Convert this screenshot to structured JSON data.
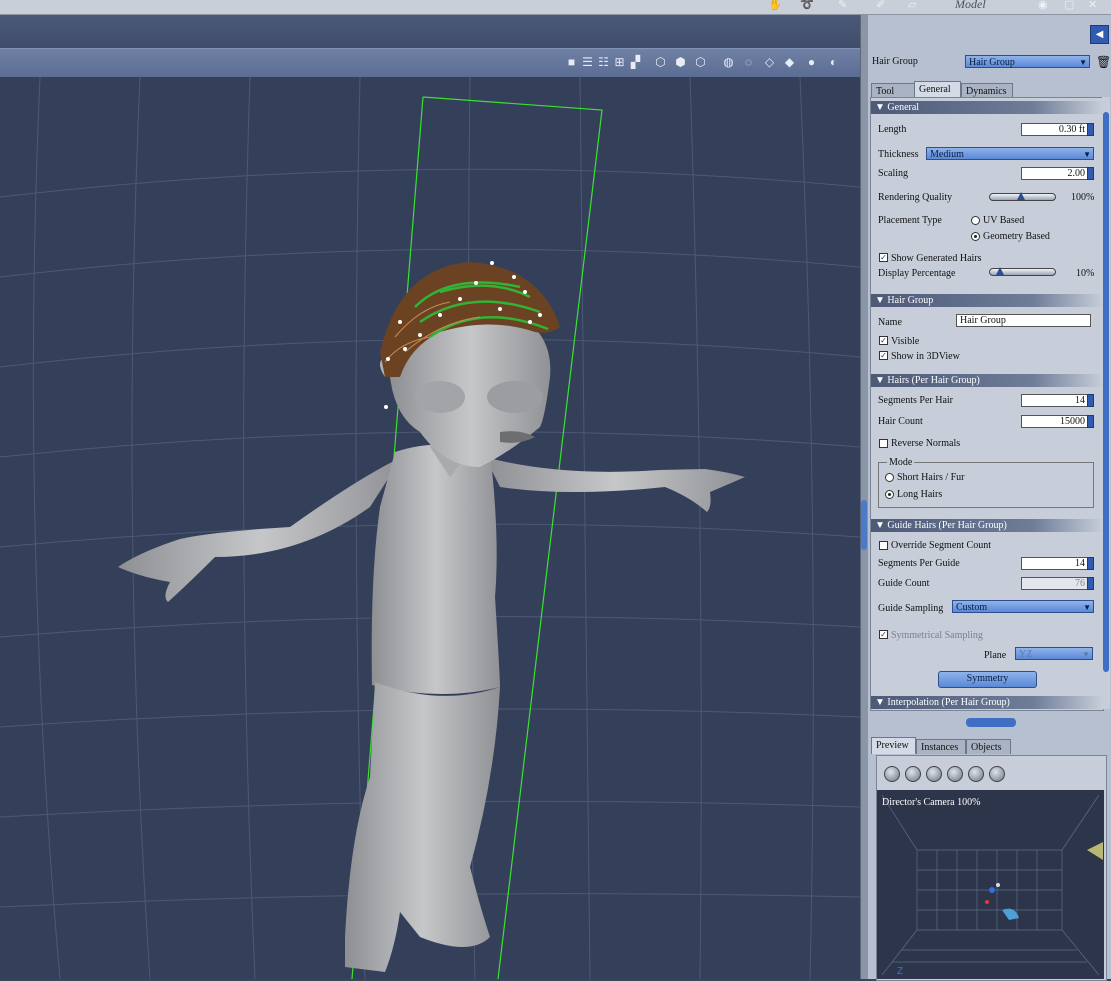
{
  "topbar": {
    "mode_label": "Model"
  },
  "hair_group_selector": {
    "label": "Hair Group",
    "value": "Hair Group"
  },
  "tabs": [
    "Tool",
    "General",
    "Dynamics"
  ],
  "active_tab": "General",
  "sections": {
    "general": {
      "title": "General",
      "length_label": "Length",
      "length_value": "0.30 ft",
      "thickness_label": "Thickness",
      "thickness_value": "Medium",
      "scaling_label": "Scaling",
      "scaling_value": "2.00",
      "rendering_quality_label": "Rendering Quality",
      "rendering_quality_value": "100%",
      "rendering_quality_level": 0.45,
      "placement_type_label": "Placement Type",
      "placement_options": [
        "UV Based",
        "Geometry Based"
      ],
      "placement_selected": "Geometry Based",
      "show_generated_label": "Show Generated Hairs",
      "show_generated_checked": true,
      "display_percentage_label": "Display Percentage",
      "display_percentage_value": "10%",
      "display_percentage_level": 0.1
    },
    "hair_group": {
      "title": "Hair Group",
      "name_label": "Name",
      "name_value": "Hair Group",
      "visible_label": "Visible",
      "show_3d_label": "Show in 3DView"
    },
    "hairs": {
      "title": "Hairs (Per Hair Group)",
      "segments_label": "Segments Per Hair",
      "segments_value": "14",
      "count_label": "Hair Count",
      "count_value": "15000",
      "reverse_label": "Reverse Normals",
      "mode_label": "Mode",
      "mode_options": [
        "Short Hairs / Fur",
        "Long Hairs"
      ],
      "mode_selected": "Long Hairs"
    },
    "guide_hairs": {
      "title": "Guide Hairs (Per Hair Group)",
      "override_label": "Override Segment Count",
      "segments_label": "Segments Per Guide",
      "segments_value": "14",
      "count_label": "Guide Count",
      "count_value": "76",
      "sampling_label": "Guide Sampling",
      "sampling_value": "Custom",
      "symmetrical_label": "Symmetrical Sampling",
      "plane_label": "Plane",
      "plane_value": "YZ",
      "symmetry_button": "Symmetry"
    },
    "interpolation": {
      "title": "Interpolation (Per Hair Group)"
    }
  },
  "bottom_tabs": [
    "Preview",
    "Instances",
    "Objects"
  ],
  "bottom_active_tab": "Preview",
  "preview": {
    "camera_label": "Director's Camera 100%",
    "axis_label": "Z"
  },
  "colors": {
    "accent": "#5b89d6",
    "panel_bg": "#b7c0d0",
    "viewport_bg": "#34405a",
    "bounding_box": "#39e22f"
  }
}
